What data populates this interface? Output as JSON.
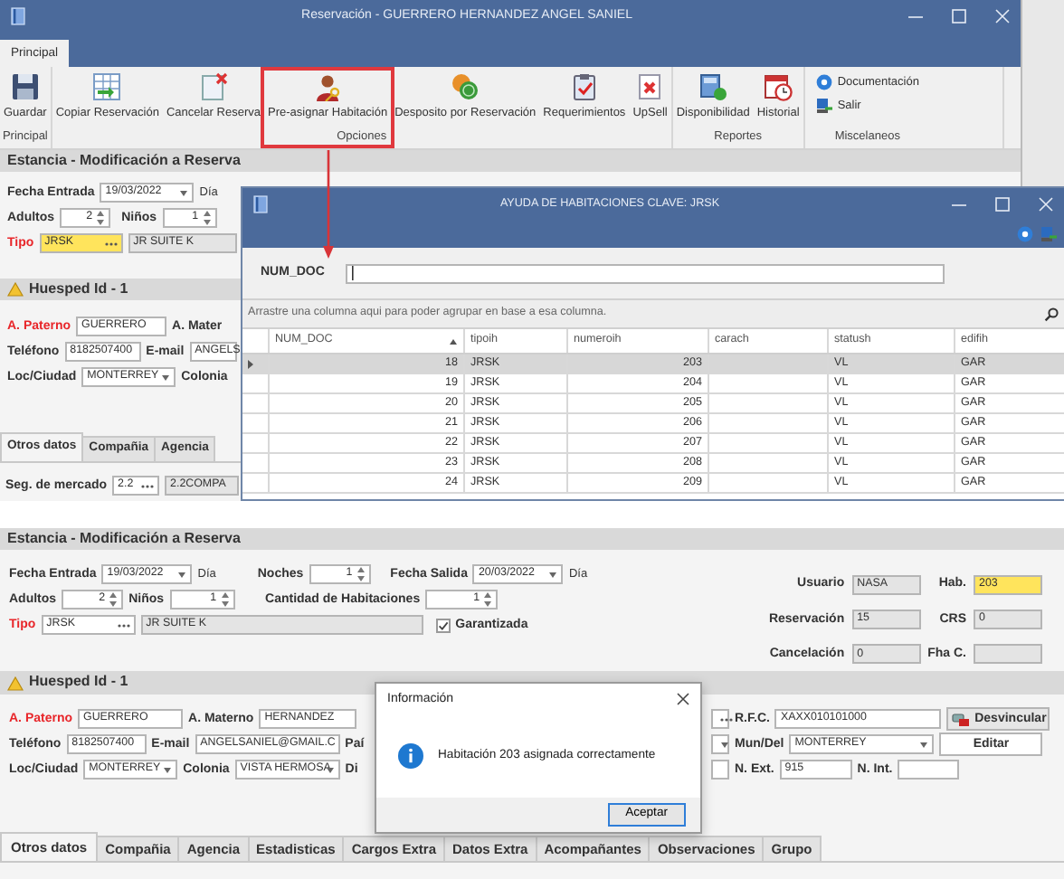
{
  "main_window": {
    "title": "Reservación - GUERRERO HERNANDEZ ANGEL SANIEL",
    "ribbon_tabs": [
      {
        "label": "Principal",
        "selected": true
      }
    ],
    "ribbon_groups": [
      {
        "label": "Principal",
        "buttons": [
          {
            "label": "Guardar",
            "kind": "large",
            "highlighted": false
          }
        ]
      },
      {
        "label": "Opciones",
        "buttons": [
          {
            "label": "Copiar Reservación",
            "kind": "large",
            "highlighted": false
          },
          {
            "label": "Cancelar Reserva",
            "kind": "large",
            "highlighted": false
          },
          {
            "label": "Pre-asignar Habitación",
            "kind": "large",
            "highlighted": true
          },
          {
            "label": "Desposito por Reservación",
            "kind": "large",
            "highlighted": false
          },
          {
            "label": "Requerimientos",
            "kind": "large",
            "highlighted": false
          },
          {
            "label": "UpSell",
            "kind": "large",
            "highlighted": false
          }
        ]
      },
      {
        "label": "Reportes",
        "buttons": [
          {
            "label": "Disponibilidad",
            "kind": "large",
            "highlighted": false
          },
          {
            "label": "Historial",
            "kind": "large",
            "highlighted": false
          }
        ]
      },
      {
        "label": "Miscelaneos",
        "buttons": [
          {
            "label": "Documentación",
            "kind": "small",
            "highlighted": false
          },
          {
            "label": "Salir",
            "kind": "small",
            "highlighted": false
          }
        ]
      }
    ],
    "section_title": "Estancia - Modificación a Reserva",
    "stay_rows": [
      [
        {
          "kind": "label",
          "text": "Fecha Entrada",
          "required": false
        },
        {
          "kind": "date",
          "value": "19/03/2022"
        },
        {
          "kind": "unit",
          "text": "Día"
        }
      ],
      [
        {
          "kind": "label",
          "text": "Adultos",
          "required": false
        },
        {
          "kind": "spin",
          "value": "2"
        },
        {
          "kind": "label",
          "text": "Niños",
          "required": false
        },
        {
          "kind": "spin",
          "value": "1"
        }
      ],
      [
        {
          "kind": "label",
          "text": "Tipo",
          "required": true
        },
        {
          "kind": "lookup",
          "value": "JRSK",
          "highlighted": true
        },
        {
          "kind": "text",
          "value": "JR SUITE K",
          "readonly": true
        }
      ]
    ],
    "guest_title": "Huesped Id - 1",
    "guest_rows": [
      [
        {
          "kind": "label",
          "text": "A. Paterno",
          "required": true
        },
        {
          "kind": "text",
          "value": "GUERRERO",
          "readonly": false
        },
        {
          "kind": "label",
          "text": "A. Mater",
          "required": false
        }
      ],
      [
        {
          "kind": "label",
          "text": "Teléfono",
          "required": false
        },
        {
          "kind": "text",
          "value": "8182507400",
          "readonly": false
        },
        {
          "kind": "label",
          "text": "E-mail",
          "required": false
        },
        {
          "kind": "text",
          "value": "ANGELS",
          "readonly": false
        }
      ],
      [
        {
          "kind": "label",
          "text": "Loc/Ciudad",
          "required": false
        },
        {
          "kind": "combo",
          "value": "MONTERREY"
        },
        {
          "kind": "label",
          "text": "Colonia",
          "required": false
        }
      ]
    ],
    "tabs": [
      {
        "label": "Otros datos",
        "selected": true
      },
      {
        "label": "Compañia",
        "selected": false
      },
      {
        "label": "Agencia",
        "selected": false
      }
    ],
    "tab_rows": [
      [
        {
          "kind": "label",
          "text": "Seg. de mercado",
          "required": false
        },
        {
          "kind": "lookup",
          "value": "2.2",
          "highlighted": false
        },
        {
          "kind": "text",
          "value": "2.2COMPA",
          "readonly": true
        }
      ]
    ]
  },
  "room_help_dialog": {
    "title": "AYUDA DE HABITACIONES CLAVE: JRSK",
    "filter_label": "NUM_DOC",
    "group_hint": "Arrastre una columna aqui para poder agrupar en base a esa columna.",
    "columns": [
      {
        "label": "NUM_DOC",
        "sorted": true
      },
      {
        "label": "tipoih",
        "sorted": false
      },
      {
        "label": "numeroih",
        "sorted": false
      },
      {
        "label": "carach",
        "sorted": false
      },
      {
        "label": "statush",
        "sorted": false
      },
      {
        "label": "edifih",
        "sorted": false
      }
    ],
    "rows": [
      {
        "num_doc": "18",
        "tipoih": "JRSK",
        "numeroih": "203",
        "statush": "VL",
        "edifih": "GAR",
        "selected": true
      },
      {
        "num_doc": "19",
        "tipoih": "JRSK",
        "numeroih": "204",
        "statush": "VL",
        "edifih": "GAR",
        "selected": false
      },
      {
        "num_doc": "20",
        "tipoih": "JRSK",
        "numeroih": "205",
        "statush": "VL",
        "edifih": "GAR",
        "selected": false
      },
      {
        "num_doc": "21",
        "tipoih": "JRSK",
        "numeroih": "206",
        "statush": "VL",
        "edifih": "GAR",
        "selected": false
      },
      {
        "num_doc": "22",
        "tipoih": "JRSK",
        "numeroih": "207",
        "statush": "VL",
        "edifih": "GAR",
        "selected": false
      },
      {
        "num_doc": "23",
        "tipoih": "JRSK",
        "numeroih": "208",
        "statush": "VL",
        "edifih": "GAR",
        "selected": false
      },
      {
        "num_doc": "24",
        "tipoih": "JRSK",
        "numeroih": "209",
        "statush": "VL",
        "edifih": "GAR",
        "selected": false
      }
    ]
  },
  "second_window": {
    "section_title": "Estancia - Modificación a Reserva",
    "stay_rows": [
      [
        {
          "kind": "label",
          "text": "Fecha Entrada",
          "required": false
        },
        {
          "kind": "date",
          "value": "19/03/2022"
        },
        {
          "kind": "unit",
          "text": "Día"
        },
        {
          "kind": "label",
          "text": "Noches",
          "required": false
        },
        {
          "kind": "spin",
          "value": "1"
        },
        {
          "kind": "label",
          "text": "Fecha Salida",
          "required": false
        },
        {
          "kind": "date",
          "value": "20/03/2022"
        },
        {
          "kind": "unit",
          "text": "Día"
        }
      ],
      [
        {
          "kind": "label",
          "text": "Adultos",
          "required": false
        },
        {
          "kind": "spin",
          "value": "2"
        },
        {
          "kind": "label",
          "text": "Niños",
          "required": false
        },
        {
          "kind": "spin",
          "value": "1"
        },
        {
          "kind": "label",
          "text": "Cantidad de Habitaciones",
          "required": false
        },
        {
          "kind": "spin",
          "value": "1"
        }
      ],
      [
        {
          "kind": "label",
          "text": "Tipo",
          "required": true
        },
        {
          "kind": "lookup",
          "value": "JRSK",
          "highlighted": false
        },
        {
          "kind": "text",
          "value": "JR SUITE K",
          "readonly": true
        },
        {
          "kind": "check",
          "text": "Garantizada",
          "checked": true
        }
      ]
    ],
    "summary": [
      {
        "label": "Usuario",
        "value": "NASA",
        "highlighted": false
      },
      {
        "label": "Hab.",
        "value": "203",
        "highlighted": true
      },
      {
        "label": "Reservación",
        "value": "15",
        "highlighted": false
      },
      {
        "label": "CRS",
        "value": "0",
        "highlighted": false
      },
      {
        "label": "Cancelación",
        "value": "0",
        "highlighted": false
      },
      {
        "label": "Fha C.",
        "highlighted": false
      }
    ],
    "guest_title": "Huesped Id - 1",
    "guest_rows": [
      {
        "left": [
          {
            "kind": "label",
            "text": "A. Paterno",
            "required": true
          },
          {
            "kind": "text",
            "value": "GUERRERO",
            "readonly": false
          },
          {
            "kind": "label",
            "text": "A. Materno",
            "required": false
          },
          {
            "kind": "text",
            "value": "HERNANDEZ",
            "readonly": false
          }
        ],
        "right": [
          {
            "kind": "lookup",
            "highlighted": false
          },
          {
            "kind": "label",
            "text": "R.F.C.",
            "required": false
          },
          {
            "kind": "text",
            "value": "XAXX010101000",
            "readonly": false
          },
          {
            "kind": "icon_button",
            "label": "Desvincular"
          }
        ]
      },
      {
        "left": [
          {
            "kind": "label",
            "text": "Teléfono",
            "required": false
          },
          {
            "kind": "text",
            "value": "8182507400",
            "readonly": false
          },
          {
            "kind": "label",
            "text": "E-mail",
            "required": false
          },
          {
            "kind": "text",
            "value": "ANGELSANIEL@GMAIL.C",
            "readonly": false
          },
          {
            "kind": "label",
            "text": "Paí",
            "required": false
          }
        ],
        "right": [
          {
            "kind": "combo"
          },
          {
            "kind": "label",
            "text": "Mun/Del",
            "required": false
          },
          {
            "kind": "combo",
            "value": "MONTERREY"
          },
          {
            "kind": "button",
            "label": "Editar"
          }
        ]
      },
      {
        "left": [
          {
            "kind": "label",
            "text": "Loc/Ciudad",
            "required": false
          },
          {
            "kind": "combo",
            "value": "MONTERREY"
          },
          {
            "kind": "label",
            "text": "Colonia",
            "required": false
          },
          {
            "kind": "combo",
            "value": "VISTA HERMOSA"
          },
          {
            "kind": "label",
            "text": "Di",
            "required": false
          }
        ],
        "right": [
          {
            "kind": "text",
            "readonly": false
          },
          {
            "kind": "label",
            "text": "N. Ext.",
            "required": false
          },
          {
            "kind": "text",
            "value": "915",
            "readonly": false
          },
          {
            "kind": "label",
            "text": "N. Int.",
            "required": false
          },
          {
            "kind": "text",
            "readonly": false
          }
        ]
      }
    ],
    "tabs": [
      {
        "label": "Otros datos",
        "selected": true
      },
      {
        "label": "Compañia",
        "selected": false
      },
      {
        "label": "Agencia",
        "selected": false
      },
      {
        "label": "Estadisticas",
        "selected": false
      },
      {
        "label": "Cargos Extra",
        "selected": false
      },
      {
        "label": "Datos Extra",
        "selected": false
      },
      {
        "label": "Acompañantes",
        "selected": false
      },
      {
        "label": "Observaciones",
        "selected": false
      },
      {
        "label": "Grupo",
        "selected": false
      }
    ],
    "message_box": {
      "title": "Información",
      "message": "Habitación 203 asignada correctamente",
      "button": "Aceptar"
    }
  }
}
